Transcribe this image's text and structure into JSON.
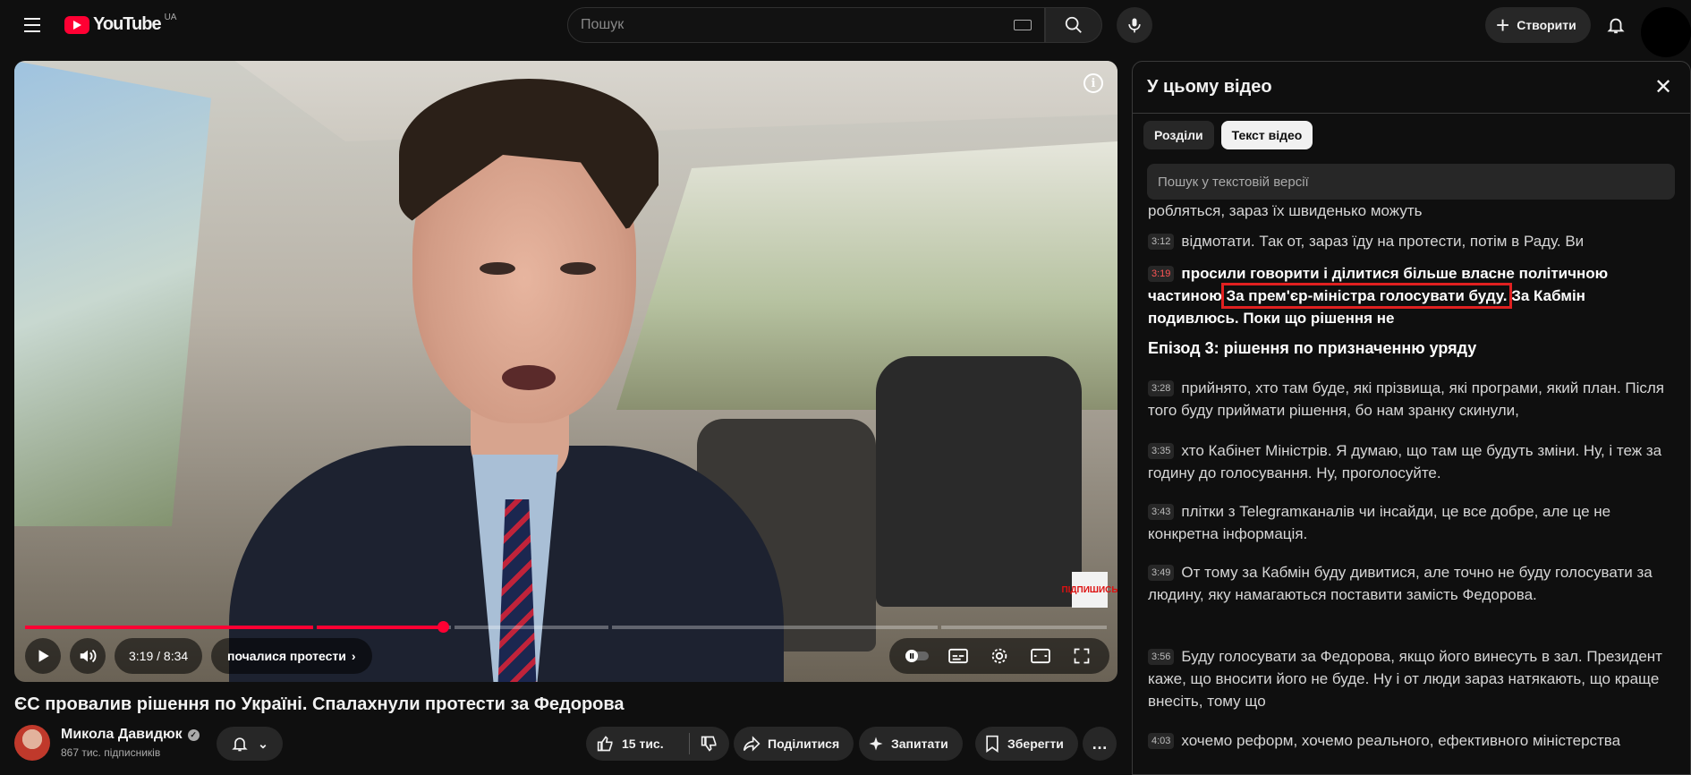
{
  "header": {
    "logo_text": "YouTube",
    "country_code": "UA",
    "search_placeholder": "Пошук",
    "create_label": "Створити",
    "icons": [
      "menu-icon",
      "search-icon",
      "mic-icon",
      "plus-icon",
      "bell-icon"
    ]
  },
  "player": {
    "time": "3:19 / 8:34",
    "chapter": "почалися протести",
    "subscribe_badge": "ПІДПИШИСЬ",
    "progress_fraction": 0.386,
    "info_icon": "i",
    "icons": [
      "play-icon",
      "volume-icon",
      "autoplay-toggle",
      "subtitles-icon",
      "settings-icon",
      "theater-icon",
      "fullscreen-icon"
    ]
  },
  "video": {
    "title": "ЄС провалив рішення по Україні. Спалахнули протести за Федорова",
    "channel_name": "Микола Давидюк",
    "subscribers": "867 тис. підписників",
    "likes": "15 тис.",
    "share_label": "Поділитися",
    "ask_label": "Запитати",
    "save_label": "Зберегти",
    "more_label": "…"
  },
  "panel": {
    "title": "У цьому відео",
    "tabs": [
      {
        "label": "Розділи",
        "active": false
      },
      {
        "label": "Текст відео",
        "active": true
      }
    ],
    "search_placeholder": "Пошук у текстовій версії",
    "chapter_heading": "Епізод 3: рішення по призначенню уряду",
    "partial_top": "робляться, зараз їх швиденько можуть",
    "lines": [
      {
        "time": "3:12",
        "text": "відмотати. Так от, зараз їду на протести, потім в Раду. Ви"
      },
      {
        "time": "3:19",
        "text_before": "просили говорити і ділитися більше власне політичною частиною",
        "highlighted": "За прем'єр-міністра голосувати буду.",
        "text_after": "За Кабмін подивлюсь. Поки що рішення не"
      },
      {
        "time": "3:28",
        "text": "прийнято, хто там буде, які прізвища, які програми, який план. Після того буду приймати рішення, бо нам зранку скинули,"
      },
      {
        "time": "3:35",
        "text": "хто Кабінет Міністрів. Я думаю, що там ще будуть зміни. Ну, і теж за годину до голосування. Ну, проголосуйте."
      },
      {
        "time": "3:43",
        "text": "плітки з Telegramканалів чи інсайди, це все добре, але це не конкретна інформація."
      },
      {
        "time": "3:49",
        "text": "От тому за Кабмін буду дивитися, але точно не буду голосувати за людину, яку намагаються поставити замість Федорова."
      },
      {
        "time": "3:56",
        "text": "Буду голосувати за Федорова, якщо його винесуть в зал. Президент каже, що вносити його не буде. Ну і от люди зараз натякають, що краще внесіть, тому що"
      },
      {
        "time": "4:03",
        "text": "хочемо реформ, хочемо реального, ефективного міністерства"
      }
    ]
  }
}
